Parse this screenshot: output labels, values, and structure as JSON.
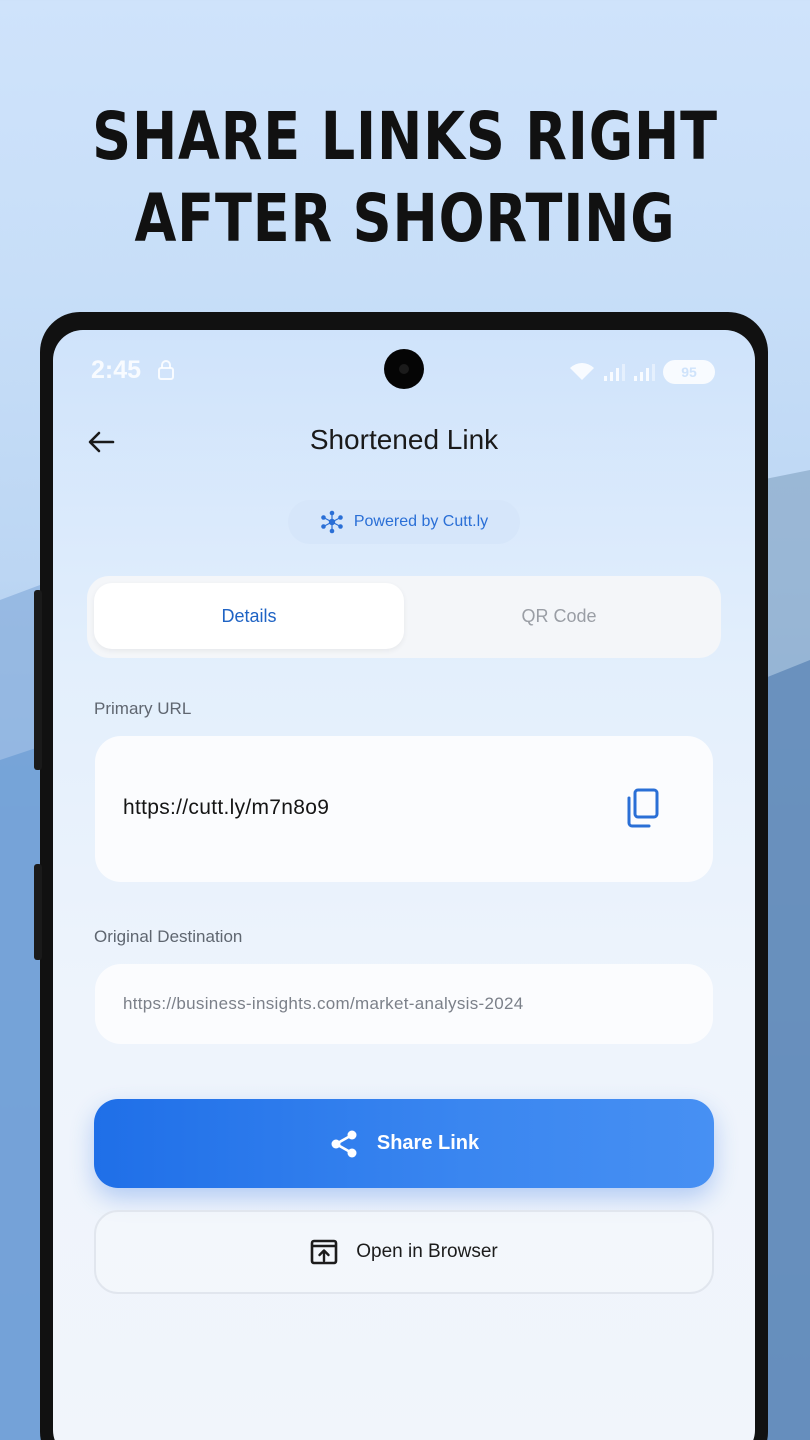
{
  "headline": {
    "line1": "SHARE LINKS RIGHT",
    "line2": "AFTER SHORTING"
  },
  "status_bar": {
    "time": "2:45",
    "battery": "95"
  },
  "header": {
    "title": "Shortened Link"
  },
  "badge": {
    "text": "Powered by Cutt.ly"
  },
  "tabs": [
    {
      "label": "Details",
      "active": true
    },
    {
      "label": "QR Code",
      "active": false
    }
  ],
  "primary": {
    "label": "Primary URL",
    "value": "https://cutt.ly/m7n8o9"
  },
  "original": {
    "label": "Original Destination",
    "value": "https://business-insights.com/market-analysis-2024"
  },
  "actions": {
    "share_label": "Share Link",
    "open_label": "Open in Browser"
  },
  "colors": {
    "accent": "#2a7ae8",
    "tab_active_text": "#1f63c4",
    "text_dark": "#1a1a1a"
  }
}
